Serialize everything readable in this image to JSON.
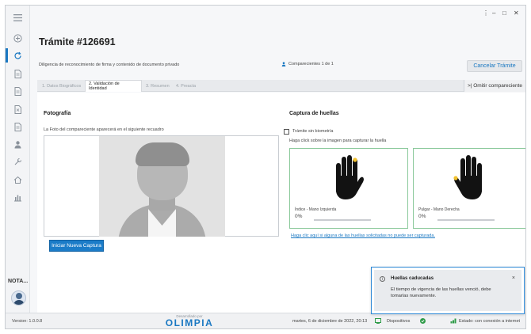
{
  "window": {
    "controls": [
      "⋮",
      "–",
      "□",
      "✕"
    ]
  },
  "sidebar": {
    "items": [
      {
        "icon": "plus-circle-icon"
      },
      {
        "icon": "refresh-icon",
        "active": true
      },
      {
        "icon": "document-icon"
      },
      {
        "icon": "document-icon"
      },
      {
        "icon": "document-icon"
      },
      {
        "icon": "document-icon"
      },
      {
        "icon": "user-icon"
      },
      {
        "icon": "tools-icon"
      },
      {
        "icon": "home-icon"
      },
      {
        "icon": "chart-icon"
      }
    ],
    "nota_label": "NOTA...",
    "menu_icon": "hamburger-icon"
  },
  "header": {
    "title": "Trámite #126691",
    "description": "Diligencia de reconocimiento de firma y contenido de documento privado",
    "comparecientes": "Comparecientes 1 de 1",
    "cancel_label": "Cancelar Trámite"
  },
  "tabs": [
    {
      "label": "1. Datos Biográficos",
      "active": false
    },
    {
      "label": "2. Validación de Identidad",
      "active": true
    },
    {
      "label": "3. Resumen",
      "active": false
    },
    {
      "label": "4. Preacta",
      "active": false
    }
  ],
  "omit_label": ">| Omitir compareciente",
  "photo": {
    "title": "Fotografía",
    "hint": "La Foto del compareciente aparecerá en el siguiente recuadro",
    "capture_button": "Iniciar Nueva Captura"
  },
  "fingerprints": {
    "title": "Captura de huellas",
    "no_biometrics_label": "Trámite sin biometría",
    "instruction": "Haga click sobre la imagen para capturar la huella",
    "cards": [
      {
        "label": "Índice - Mano Izquierda",
        "percent": "0%",
        "progress": 0
      },
      {
        "label": "Pulgar - Mano Derecha",
        "percent": "0%",
        "progress": 0
      }
    ],
    "help_link": "Haga clic aquí si alguna de las huellas solicitadas no puede ser capturada."
  },
  "toast": {
    "title": "Huellas caducadas",
    "message": "El tiempo de vigencia de las huellas venció, debe tomarlas nuevamente.",
    "close": "×"
  },
  "status": {
    "version": "Version: 1.0.0.8",
    "developed_by": "Desarrollado por",
    "brand": "OLIMPIA",
    "datetime": "martes, 6 de diciembre de 2022, 20:13",
    "devices": "Dispositivos",
    "connection": "Estado: con conexión a internet"
  },
  "colors": {
    "accent": "#1a78c2",
    "card_border": "#8bc99b",
    "fingertip": "#f2c230",
    "toast_border": "#2b87d6"
  }
}
